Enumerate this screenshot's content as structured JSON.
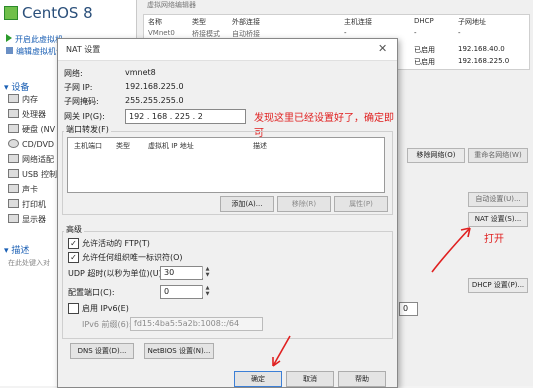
{
  "vm": {
    "title": "CentOS 8",
    "actions": [
      "开启此虚拟机",
      "编辑虚拟机设置"
    ]
  },
  "left_panel": {
    "devices_title": "设备",
    "devices": [
      "内存",
      "处理器",
      "硬盘 (NV",
      "CD/DVD",
      "网络适配",
      "USB 控制",
      "声卡",
      "打印机",
      "显示器"
    ],
    "desc_title": "描述",
    "desc_text": "在此处键入对"
  },
  "vnet": {
    "title": "虚拟网络编辑器",
    "headers": [
      "名称",
      "类型",
      "外部连接",
      "主机连接",
      "DHCP",
      "子网地址"
    ],
    "rows": [
      [
        "VMnet0",
        "桥接模式",
        "自动桥接",
        "-",
        "-",
        "-"
      ],
      [
        "",
        "",
        "",
        "",
        "已启用",
        "192.168.40.0"
      ],
      [
        "",
        "",
        "",
        "",
        "已启用",
        "192.168.225.0"
      ]
    ],
    "remove_net": "移除网络(O)",
    "rename_net": "重命名网络(W)",
    "auto_set": "自动设置(U)...",
    "nat_set": "NAT 设置(S)...",
    "dhcp_set": "DHCP 设置(P)...",
    "field_value": "0"
  },
  "dialog": {
    "title": "NAT 设置",
    "network_label": "网络:",
    "network_value": "vmnet8",
    "subnet_ip_label": "子网 IP:",
    "subnet_ip_value": "192.168.225.0",
    "mask_label": "子网掩码:",
    "mask_value": "255.255.255.0",
    "gateway_label": "网关 IP(G):",
    "gateway_value": "192 . 168 . 225 . 2",
    "pf_title": "端口转发(F)",
    "pf_headers": [
      "主机端口",
      "类型",
      "虚拟机 IP 地址",
      "描述"
    ],
    "add": "添加(A)...",
    "remove": "移除(R)",
    "props": "属性(P)",
    "adv_title": "高级",
    "allow_ftp": "允许活动的 FTP(T)",
    "allow_uid": "允许任何组织唯一标识符(O)",
    "udp_label": "UDP 超时(以秒为单位)(U):",
    "udp_value": "30",
    "cfg_port_label": "配置端口(C):",
    "cfg_port_value": "0",
    "ipv6_label": "启用 IPv6(E)",
    "ipv6_prefix_label": "IPv6 前缀(6):",
    "ipv6_prefix_value": "fd15:4ba5:5a2b:1008::/64",
    "dns": "DNS 设置(D)...",
    "netbios": "NetBIOS 设置(N)...",
    "ok": "确定",
    "cancel": "取消",
    "help": "帮助"
  },
  "annotations": {
    "note": "发现这里已经设置好了，确定即可",
    "open": "打开"
  },
  "colors": {
    "annotation": "#e02020",
    "accent": "#1a5fb4"
  }
}
